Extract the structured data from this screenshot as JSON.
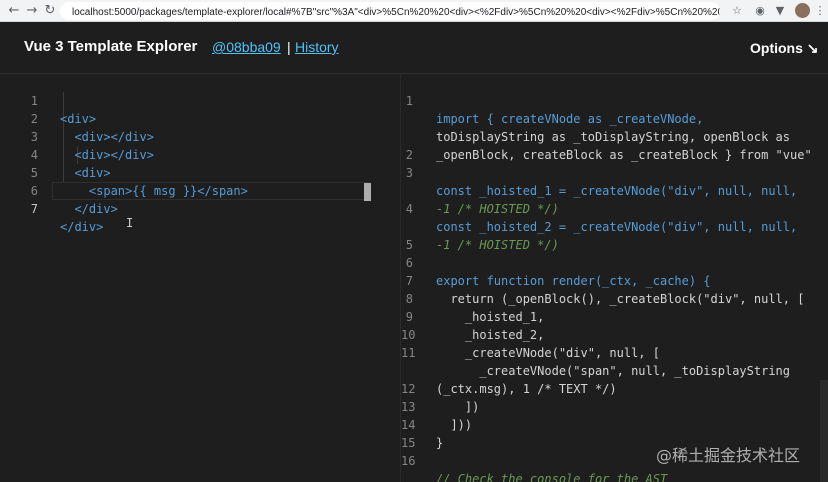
{
  "browser": {
    "url": "localhost:5000/packages/template-explorer/local#%7B\"src\"%3A\"<div>%5Cn%20%20<div><%2Fdiv>%5Cn%20%20<div><%2Fdiv>%5Cn%20%20<div>%5Cn..."
  },
  "header": {
    "title": "Vue 3 Template Explorer",
    "commit": "@08bba09",
    "separator": "|",
    "history": "History",
    "options": "Options ↘"
  },
  "left_editor": {
    "line_numbers": [
      "1",
      "2",
      "3",
      "4",
      "5",
      "6",
      "7"
    ],
    "lines": [
      "<div>",
      "  <div></div>",
      "  <div></div>",
      "  <div>",
      "    <span>{{ msg }}</span>",
      "  </div>",
      "</div>"
    ]
  },
  "right_editor": {
    "line_numbers": [
      "1",
      "",
      "",
      "2",
      "3",
      "",
      "4",
      "",
      "5",
      "6",
      "7",
      "8",
      "9",
      "10",
      "11",
      "",
      "12",
      "13",
      "14",
      "15",
      "16"
    ],
    "lines": [
      "import { createVNode as _createVNode,",
      "toDisplayString as _toDisplayString, openBlock as",
      "_openBlock, createBlock as _createBlock } from \"vue\"",
      "",
      "const _hoisted_1 = _createVNode(\"div\", null, null,",
      "-1 /* HOISTED */)",
      "const _hoisted_2 = _createVNode(\"div\", null, null,",
      "-1 /* HOISTED */)",
      "",
      "export function render(_ctx, _cache) {",
      "  return (_openBlock(), _createBlock(\"div\", null, [",
      "    _hoisted_1,",
      "    _hoisted_2,",
      "    _createVNode(\"div\", null, [",
      "      _createVNode(\"span\", null, _toDisplayString",
      "(_ctx.msg), 1 /* TEXT */)",
      "    ])",
      "  ]))",
      "}",
      "",
      "// Check the console for the AST"
    ]
  },
  "watermark": "@稀土掘金技术社区"
}
